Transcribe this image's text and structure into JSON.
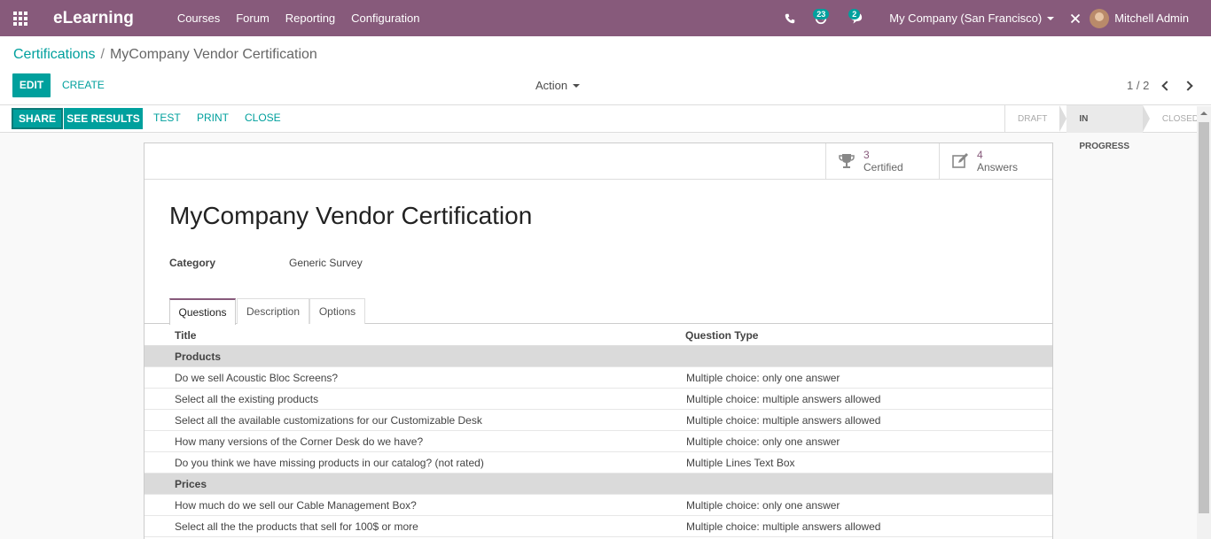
{
  "navbar": {
    "brand": "eLearning",
    "menu": [
      "Courses",
      "Forum",
      "Reporting",
      "Configuration"
    ],
    "activity_badge": "23",
    "messages_badge": "2",
    "company": "My Company (San Francisco)",
    "user": "Mitchell Admin"
  },
  "breadcrumb": {
    "parent": "Certifications",
    "separator": "/",
    "current": "MyCompany Vendor Certification"
  },
  "control": {
    "edit": "EDIT",
    "create": "CREATE",
    "action": "Action",
    "pager": "1 / 2"
  },
  "statusbar": {
    "buttons": [
      "SHARE",
      "SEE RESULTS",
      "TEST",
      "PRINT",
      "CLOSE"
    ],
    "stages": [
      "DRAFT",
      "IN PROGRESS",
      "CLOSED"
    ],
    "active_stage": "IN PROGRESS"
  },
  "stats": [
    {
      "value": "3",
      "label": "Certified",
      "icon": "trophy-icon"
    },
    {
      "value": "4",
      "label": "Answers",
      "icon": "edit-icon"
    }
  ],
  "form": {
    "title": "MyCompany Vendor Certification",
    "category_label": "Category",
    "category_value": "Generic Survey"
  },
  "tabs": [
    "Questions",
    "Description",
    "Options"
  ],
  "table": {
    "headers": [
      "Title",
      "Question Type"
    ],
    "rows": [
      {
        "section": true,
        "title": "Products",
        "type": ""
      },
      {
        "section": false,
        "title": "Do we sell Acoustic Bloc Screens?",
        "type": "Multiple choice: only one answer"
      },
      {
        "section": false,
        "title": "Select all the existing products",
        "type": "Multiple choice: multiple answers allowed"
      },
      {
        "section": false,
        "title": "Select all the available customizations for our Customizable Desk",
        "type": "Multiple choice: multiple answers allowed"
      },
      {
        "section": false,
        "title": "How many versions of the Corner Desk do we have?",
        "type": "Multiple choice: only one answer"
      },
      {
        "section": false,
        "title": "Do you think we have missing products in our catalog? (not rated)",
        "type": "Multiple Lines Text Box"
      },
      {
        "section": true,
        "title": "Prices",
        "type": ""
      },
      {
        "section": false,
        "title": "How much do we sell our Cable Management Box?",
        "type": "Multiple choice: only one answer"
      },
      {
        "section": false,
        "title": "Select all the the products that sell for 100$ or more",
        "type": "Multiple choice: multiple answers allowed"
      }
    ]
  },
  "colors": {
    "brand": "#875a7b",
    "accent": "#00a09d"
  }
}
